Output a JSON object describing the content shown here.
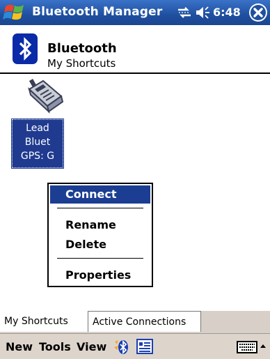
{
  "titlebar": {
    "app_title": "Bluetooth Manager",
    "time": "6:48",
    "icons": [
      "windows-start-icon",
      "connectivity-icon",
      "speaker-icon",
      "close-icon"
    ]
  },
  "header": {
    "title": "Bluetooth",
    "subtitle": "My Shortcuts"
  },
  "shortcut": {
    "label_lines": [
      "Lead",
      "Bluet",
      "GPS: G"
    ],
    "icon": "gps-device-icon"
  },
  "context_menu": {
    "items": [
      "Connect",
      "Rename",
      "Delete",
      "Properties"
    ],
    "selected": "Connect"
  },
  "tabs": [
    "My Shortcuts",
    "Active Connections"
  ],
  "menubar": {
    "new_label": "New",
    "tools_label": "Tools",
    "view_label": "View",
    "icons": [
      "bluetooth-icon",
      "contacts-icon",
      "keyboard-icon",
      "sip-arrow-icon"
    ]
  },
  "colors": {
    "titlebar": "#1f4f9f",
    "selection": "#1b3e92",
    "menubar": "#ddd5cc"
  }
}
